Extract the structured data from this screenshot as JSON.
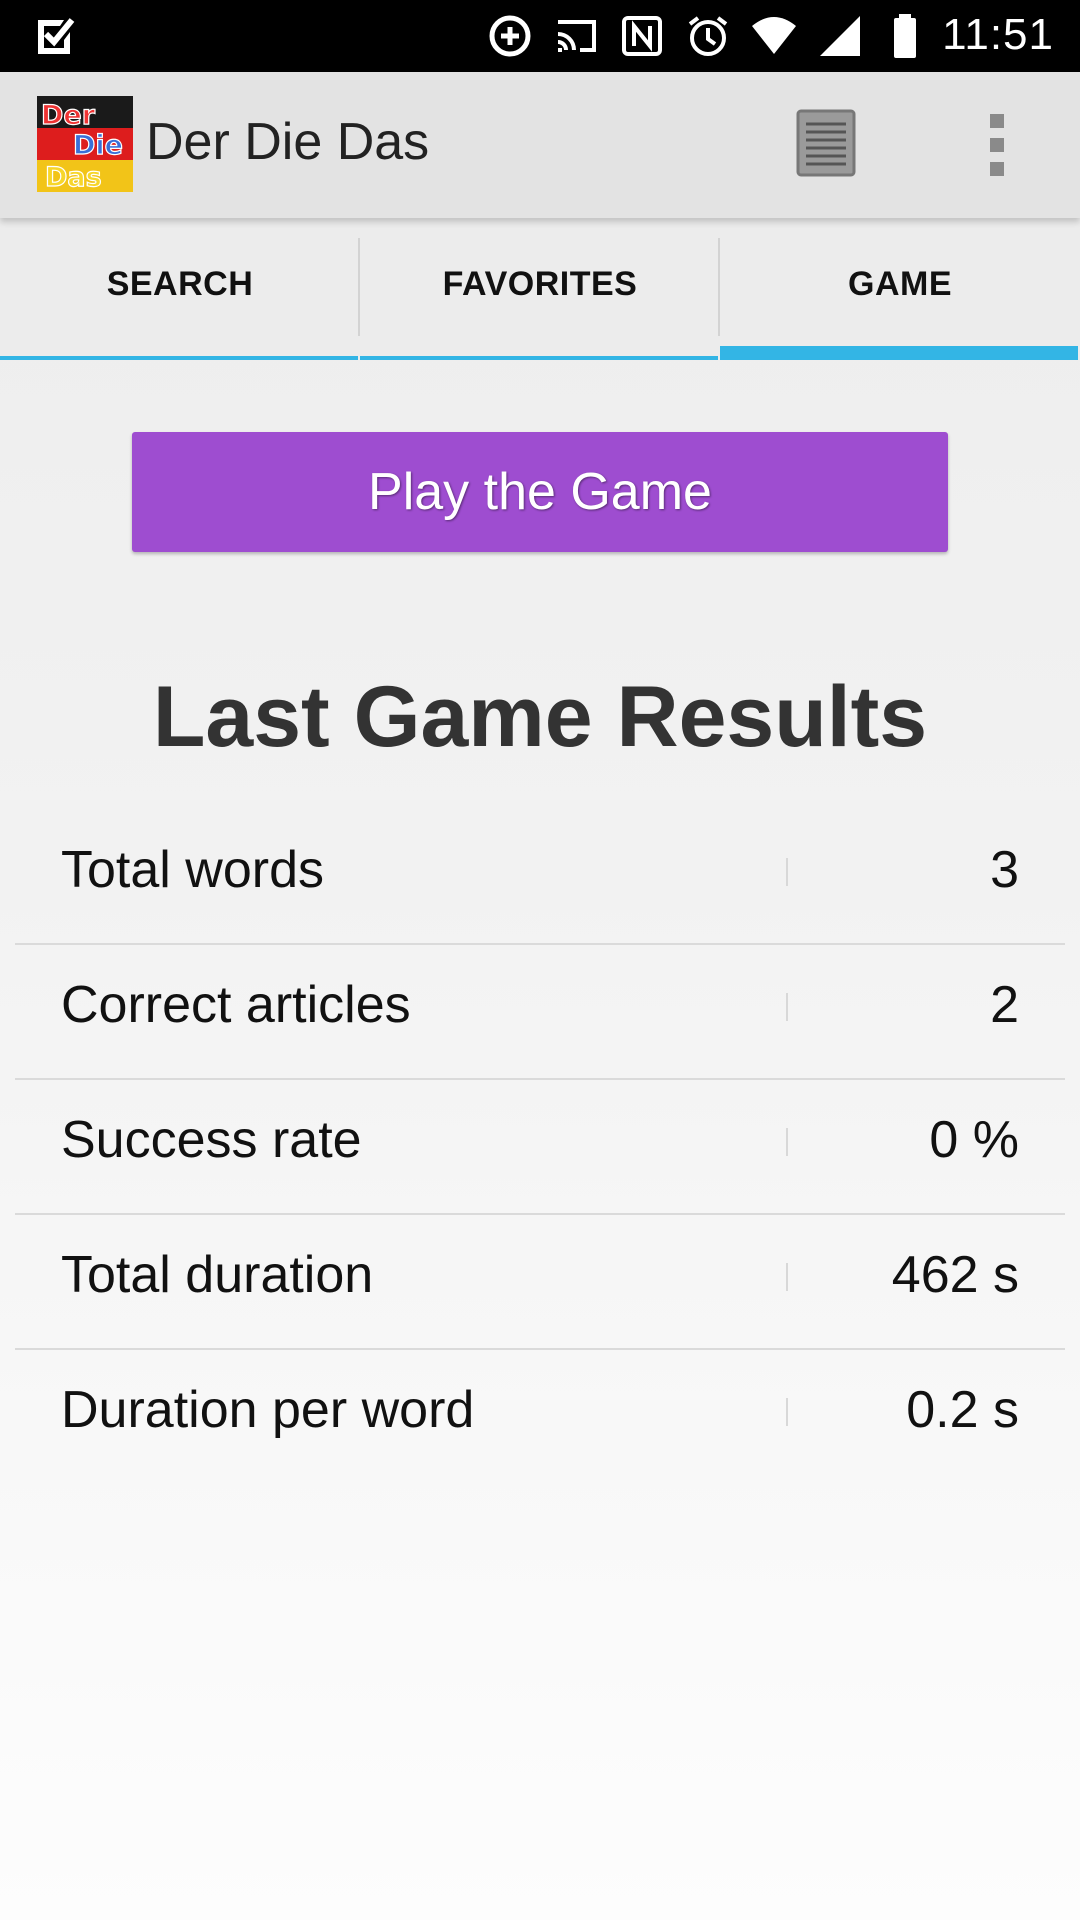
{
  "status_bar": {
    "time": "11:51",
    "icons": [
      "check-notification-icon",
      "data-saver-icon",
      "cast-icon",
      "nfc-icon",
      "alarm-icon",
      "wifi-icon",
      "signal-icon",
      "battery-icon"
    ]
  },
  "app_bar": {
    "title": "Der Die Das",
    "logo_text": [
      "Der",
      "Die",
      "Das"
    ],
    "actions": [
      "list-icon",
      "overflow-menu-icon"
    ]
  },
  "tabs": [
    {
      "label": "SEARCH",
      "active": false
    },
    {
      "label": "FAVORITES",
      "active": false
    },
    {
      "label": "GAME",
      "active": true
    }
  ],
  "colors": {
    "accent": "#33b5e5",
    "button": "#9e4dd0"
  },
  "game": {
    "play_button_label": "Play the Game",
    "results_title": "Last Game Results",
    "stats": [
      {
        "label": "Total words",
        "value": "3"
      },
      {
        "label": "Correct articles",
        "value": "2"
      },
      {
        "label": "Success rate",
        "value": "0 %"
      },
      {
        "label": "Total duration",
        "value": "462 s"
      },
      {
        "label": "Duration per word",
        "value": "0.2 s"
      }
    ]
  }
}
